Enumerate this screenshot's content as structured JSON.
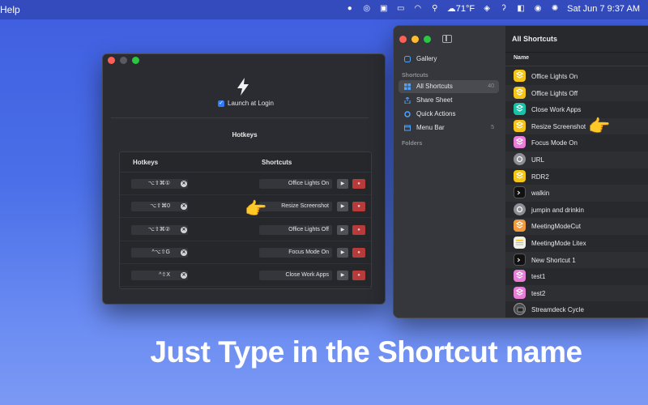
{
  "menubar": {
    "app_menu": "Help",
    "weather": "71°F",
    "datetime": "Sat Jun 7  9:37 AM",
    "icons": [
      "drop-icon",
      "target-icon",
      "gift-icon",
      "battery-icon",
      "wifi-icon",
      "search-icon",
      "weather-icon",
      "layers-icon",
      "ear-icon",
      "toggle-icon",
      "user-icon",
      "siri-icon"
    ]
  },
  "hotkeys_window": {
    "launch_at_login": "Launch at Login",
    "section_title": "Hotkeys",
    "col_hotkeys": "Hotkeys",
    "col_shortcuts": "Shortcuts",
    "rows": [
      {
        "key": "⌥⇧⌘①",
        "shortcut": "Office Lights On"
      },
      {
        "key": "⌥⇧⌘0",
        "shortcut": "Resize Screenshot"
      },
      {
        "key": "⌥⇧⌘②",
        "shortcut": "Office Lights Off"
      },
      {
        "key": "^⌥⇧G",
        "shortcut": "Focus Mode On"
      },
      {
        "key": "^⇧X",
        "shortcut": "Close Work Apps"
      }
    ]
  },
  "shortcuts_window": {
    "sidebar": {
      "gallery": "Gallery",
      "section_shortcuts": "Shortcuts",
      "items": [
        {
          "label": "All Shortcuts",
          "count": "40"
        },
        {
          "label": "Share Sheet",
          "count": ""
        },
        {
          "label": "Quick Actions",
          "count": ""
        },
        {
          "label": "Menu Bar",
          "count": "5"
        }
      ],
      "section_folders": "Folders"
    },
    "title": "All Shortcuts",
    "column_name": "Name",
    "rows": [
      {
        "name": "Office Lights On",
        "color": "yellow"
      },
      {
        "name": "Office Lights Off",
        "color": "yellow"
      },
      {
        "name": "Close Work Apps",
        "color": "teal"
      },
      {
        "name": "Resize Screenshot",
        "color": "yellow"
      },
      {
        "name": "Focus Mode On",
        "color": "pink"
      },
      {
        "name": "URL",
        "color": "gray"
      },
      {
        "name": "RDR2",
        "color": "yellow"
      },
      {
        "name": "walkin",
        "color": "dark"
      },
      {
        "name": "jumpin and drinkin",
        "color": "gray"
      },
      {
        "name": "MeetingModeCut",
        "color": "orange"
      },
      {
        "name": "MeetingMode Litex",
        "color": "white"
      },
      {
        "name": "New Shortcut 1",
        "color": "dark"
      },
      {
        "name": "test1",
        "color": "pink"
      },
      {
        "name": "test2",
        "color": "pink"
      },
      {
        "name": "Streamdeck Cycle",
        "color": "round"
      }
    ]
  },
  "tagline": "Just Type in the Shortcut name"
}
